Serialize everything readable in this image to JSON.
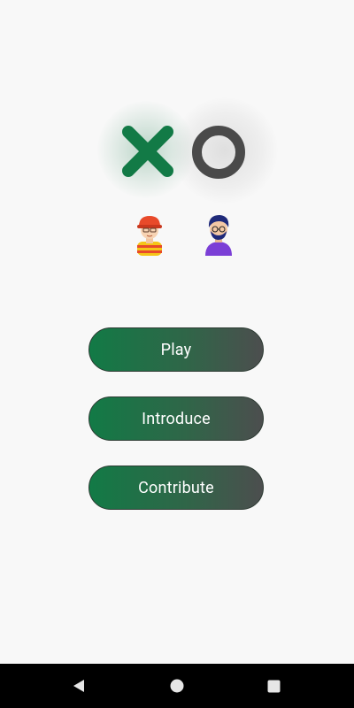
{
  "menu": {
    "play_label": "Play",
    "introduce_label": "Introduce",
    "contribute_label": "Contribute"
  },
  "logo": {
    "x_icon": "x-mark-icon",
    "o_icon": "o-mark-icon",
    "x_color": "#127a46",
    "o_color": "#4a4a4a"
  },
  "players": [
    {
      "icon": "boy-red-cap-avatar"
    },
    {
      "icon": "man-purple-shirt-avatar"
    }
  ],
  "navbar": {
    "back_icon": "back-triangle-icon",
    "home_icon": "home-circle-icon",
    "recents_icon": "recents-square-icon"
  },
  "colors": {
    "accent": "#127a46",
    "button_gradient_end": "#4c4e4e",
    "background": "#f8f8f8"
  }
}
